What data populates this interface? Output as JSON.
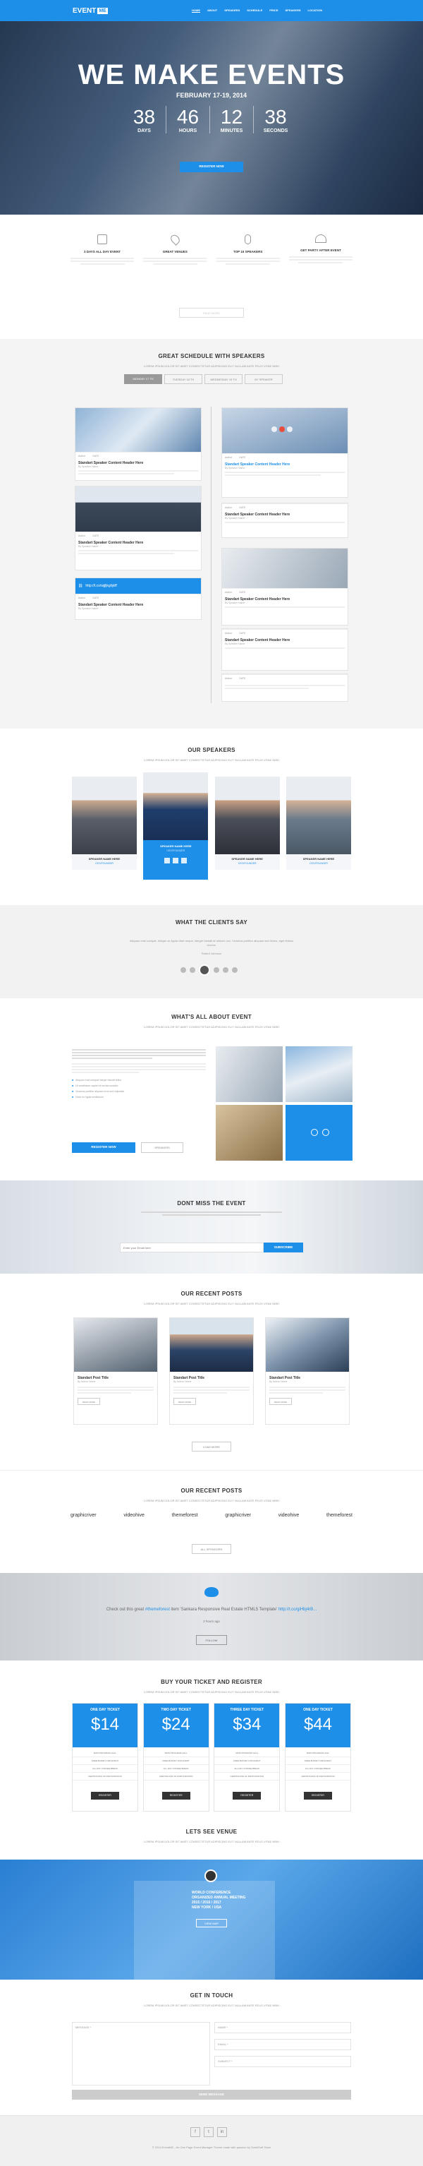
{
  "nav": {
    "logo": "EVENT",
    "logo_badge": "ME",
    "items": [
      "HOME",
      "ABOUT",
      "SPEAKERS",
      "SCHEDULE",
      "PRICE",
      "SPEAKERS",
      "LOCATION"
    ]
  },
  "hero": {
    "title": "WE MAKE EVENTS",
    "date": "FEBRUARY 17-19, 2014",
    "countdown": [
      {
        "num": "38",
        "label": "DAYS"
      },
      {
        "num": "46",
        "label": "HOURS"
      },
      {
        "num": "12",
        "label": "MINUTES"
      },
      {
        "num": "38",
        "label": "SECONDS"
      }
    ],
    "cta": "REGISTER NOW"
  },
  "features": {
    "items": [
      {
        "title": "3 DAYS ALL DAY EVENT",
        "icon": "calendar-icon"
      },
      {
        "title": "GREAT VENUES",
        "icon": "location-icon"
      },
      {
        "title": "TOP 15 SPEAKERS",
        "icon": "microphone-icon"
      },
      {
        "title": "GET PARTY AFTER EVENT",
        "icon": "party-icon"
      }
    ],
    "button": "READ MORE"
  },
  "schedule": {
    "title": "GREAT SCHEDULE WITH SPEAKERS",
    "subtitle": "LOREM IPSUM DOLOR SIT AMET CONSECTETUR ADIPISCING ELIT NULLAM ANTE FELIS VITAE NIBH",
    "tabs": [
      "MONDAY 17 TH",
      "TUESDAY 18 TH",
      "WEDNESDAY 19 TH",
      "BY SPEAKER"
    ],
    "post_title": "Standart Speaker Content Header Here",
    "post_by": "By Speaker Name",
    "link_text": "http://t.co/wjjljkghjkff",
    "meta": {
      "author": "Author",
      "date": "DATE",
      "count": "12"
    }
  },
  "speakers": {
    "title": "OUR SPEAKERS",
    "subtitle": "LOREM IPSUM DOLOR SIT AMET CONSECTETUR ADIPISCING ELIT NULLAM ANTE FELIS VITAE NIBH",
    "items": [
      {
        "name": "SPEAKER NAME HERE",
        "role": "CEO/FOUNDER"
      },
      {
        "name": "SPEAKER NAME HERE",
        "role": "CEO/FOUNDER"
      },
      {
        "name": "SPEAKER NAME HERE",
        "role": "CEO/FOUNDER"
      },
      {
        "name": "SPEAKER NAME HERE",
        "role": "CEO/FOUNDER"
      }
    ]
  },
  "clients": {
    "title": "WHAT THE CLIENTS SAY",
    "quote": "Aliquam erat volutpat. Integer ac ligula vitae neque, integer blandit at ultrices orci. Vivamus porttitor aliquam sed lectus, eget finibus viverra.",
    "author": "Robert Johnson"
  },
  "about": {
    "title": "WHAT'S ALL ABOUT EVENT",
    "subtitle": "LOREM IPSUM DOLOR SIT AMET CONSECTETUR ADIPISCING ELIT NULLAM ANTE FELIS VITAE NIBH",
    "bullets": [
      "Aliquam erat volutpat integer blandit tellus",
      "Ut vestibulum sapien et lacinia sodales",
      "Vivamus porttitor aliquam eros sed vulputate",
      "Nunc eu ligula vestibulum"
    ],
    "btn1": "REGISTER NOW",
    "btn2": "SPEAKERS"
  },
  "dontmiss": {
    "title": "DONT MISS THE EVENT",
    "placeholder": "Enter your Email here",
    "button": "SUBSCRIBE"
  },
  "posts": {
    "title": "OUR RECENT POSTS",
    "subtitle": "LOREM IPSUM DOLOR SIT AMET CONSECTETUR ADIPISCING ELIT NULLAM ANTE FELIS VITAE NIBH",
    "items": [
      {
        "title": "Standart Post Title",
        "by": "By Author Name"
      },
      {
        "title": "Standart Post Title",
        "by": "By Author Name"
      },
      {
        "title": "Standart Post Title",
        "by": "By Author Name"
      }
    ],
    "more": "READ MORE",
    "load": "LOAD MORE"
  },
  "sponsors": {
    "title": "OUR RECENT POSTS",
    "subtitle": "LOREM IPSUM DOLOR SIT AMET CONSECTETUR ADIPISCING ELIT NULLAM ANTE FELIS VITAE NIBH",
    "logos": [
      "graphicriver",
      "videohive",
      "themeforest",
      "graphicriver",
      "videohive",
      "themeforest"
    ],
    "button": "ALL SPONSORS"
  },
  "twitter": {
    "text_a": "Check out this great ",
    "handle": "#themeforest",
    "text_b": " item 'Sankara Responsive Real Estate HTML5 Template' ",
    "link": "http://t.co/giHbj4rB...",
    "time": "2 hours ago",
    "button": "FOLLOW"
  },
  "tickets": {
    "title": "BUY YOUR TICKET AND REGISTER",
    "subtitle": "LOREM IPSUM DOLOR SIT AMET CONSECTETUR ADIPISCING ELIT NULLAM ANTE FELIS VITAE NIBH",
    "items": [
      {
        "name": "ONE DAY TICKET",
        "price": "14"
      },
      {
        "name": "TWO DAY TICKET",
        "price": "24"
      },
      {
        "name": "THREE DAY TICKET",
        "price": "34"
      },
      {
        "name": "ONE DAY TICKET",
        "price": "44"
      }
    ],
    "features": [
      "MAIN PROGRAM HALL",
      "FREE BUFFET FOR EVENT",
      "ALL DAY COFFEE BREAK",
      "CERTIFICATE OF PARTICIPATION"
    ],
    "button": "REGISTER"
  },
  "venue": {
    "title": "LETS SEE VENUE",
    "subtitle": "LOREM IPSUM DOLOR SIT AMET CONSECTETUR ADIPISCING ELIT NULLAM ANTE FELIS VITAE NIBH",
    "address": [
      "WORLD CONFERENCE",
      "ORGANIZED ANNUAL MEETING",
      "2015 / 2016 / 2017",
      "NEW YORK / USA"
    ],
    "button": "VIEW MAP"
  },
  "contact": {
    "title": "GET IN TOUCH",
    "subtitle": "LOREM IPSUM DOLOR SIT AMET CONSECTETUR ADIPISCING ELIT NULLAM ANTE FELIS VITAE NIBH",
    "message": "MESSAGE *",
    "name": "NAME *",
    "email": "EMAIL *",
    "subject": "SUBJECT *",
    "send": "SEND MESSAGE"
  },
  "footer": {
    "text": "© 2014 EventME - An One Page Event Manager Theme made with passion by SurielSoft Team"
  },
  "colors": {
    "accent": "#1e8fe8",
    "dark": "#333333"
  }
}
